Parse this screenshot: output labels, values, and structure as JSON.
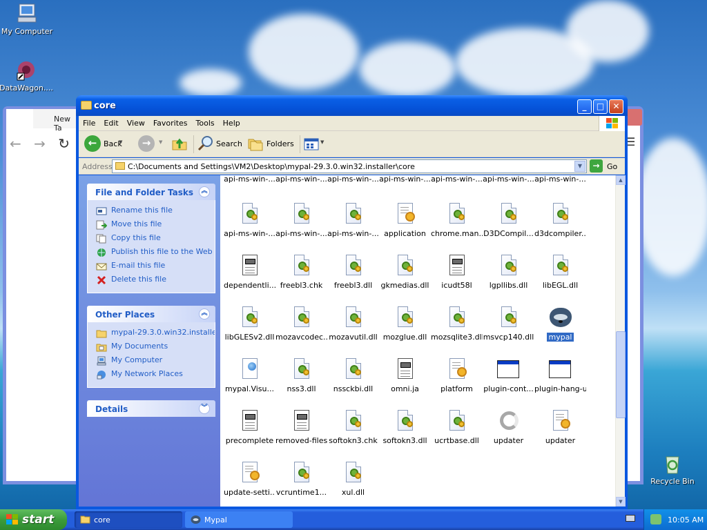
{
  "desktop": {
    "icons": [
      {
        "label": "My Computer",
        "icon": "my-computer-icon"
      },
      {
        "label": "DataWagon....",
        "icon": "datawagon-shortcut-icon"
      },
      {
        "label": "Recycle Bin",
        "icon": "recycle-bin-icon"
      }
    ]
  },
  "background_window": {
    "tab_label": "New Ta"
  },
  "explorer": {
    "title": "core",
    "menu": [
      "File",
      "Edit",
      "View",
      "Favorites",
      "Tools",
      "Help"
    ],
    "toolbar": {
      "back": "Back",
      "search": "Search",
      "folders": "Folders"
    },
    "address": {
      "label": "Address",
      "path": "C:\\Documents and Settings\\VM2\\Desktop\\mypal-29.3.0.win32.installer\\core",
      "go": "Go"
    },
    "file_tasks": {
      "title": "File and Folder Tasks",
      "items": [
        {
          "label": "Rename this file",
          "icon": "rename-icon"
        },
        {
          "label": "Move this file",
          "icon": "move-icon"
        },
        {
          "label": "Copy this file",
          "icon": "copy-icon"
        },
        {
          "label": "Publish this file to the Web",
          "icon": "publish-web-icon"
        },
        {
          "label": "E-mail this file",
          "icon": "email-icon"
        },
        {
          "label": "Delete this file",
          "icon": "delete-icon"
        }
      ]
    },
    "other_places": {
      "title": "Other Places",
      "items": [
        {
          "label": "mypal-29.3.0.win32.installe",
          "icon": "folder-icon"
        },
        {
          "label": "My Documents",
          "icon": "my-documents-icon"
        },
        {
          "label": "My Computer",
          "icon": "my-computer-icon"
        },
        {
          "label": "My Network Places",
          "icon": "network-places-icon"
        }
      ]
    },
    "details": {
      "title": "Details"
    },
    "files_partial_row": [
      "api-ms-win-...",
      "api-ms-win-...",
      "api-ms-win-...",
      "api-ms-win-...",
      "api-ms-win-...",
      "api-ms-win-...",
      "api-ms-win-..."
    ],
    "files": [
      {
        "name": "api-ms-win-...",
        "type": "dll"
      },
      {
        "name": "api-ms-win-...",
        "type": "dll"
      },
      {
        "name": "api-ms-win-...",
        "type": "dll"
      },
      {
        "name": "application",
        "type": "config"
      },
      {
        "name": "chrome.man...",
        "type": "dll"
      },
      {
        "name": "D3DCompil...",
        "type": "dll"
      },
      {
        "name": "d3dcompiler...",
        "type": "dll"
      },
      {
        "name": "dependentli...",
        "type": "text"
      },
      {
        "name": "freebl3.chk",
        "type": "dll"
      },
      {
        "name": "freebl3.dll",
        "type": "dll"
      },
      {
        "name": "gkmedias.dll",
        "type": "dll"
      },
      {
        "name": "icudt58l",
        "type": "text"
      },
      {
        "name": "lgpllibs.dll",
        "type": "dll"
      },
      {
        "name": "libEGL.dll",
        "type": "dll"
      },
      {
        "name": "libGLESv2.dll",
        "type": "dll"
      },
      {
        "name": "mozavcodec...",
        "type": "dll"
      },
      {
        "name": "mozavutil.dll",
        "type": "dll"
      },
      {
        "name": "mozglue.dll",
        "type": "dll"
      },
      {
        "name": "mozsqlite3.dll",
        "type": "dll"
      },
      {
        "name": "msvcp140.dll",
        "type": "dll"
      },
      {
        "name": "mypal",
        "type": "app-mypal",
        "selected": true
      },
      {
        "name": "mypal.Visu...",
        "type": "visual"
      },
      {
        "name": "nss3.dll",
        "type": "dll"
      },
      {
        "name": "nssckbi.dll",
        "type": "dll"
      },
      {
        "name": "omni.ja",
        "type": "text"
      },
      {
        "name": "platform",
        "type": "config"
      },
      {
        "name": "plugin-cont...",
        "type": "exe"
      },
      {
        "name": "plugin-hang-ui",
        "type": "exe"
      },
      {
        "name": "precomplete",
        "type": "text"
      },
      {
        "name": "removed-files",
        "type": "text"
      },
      {
        "name": "softokn3.chk",
        "type": "dll"
      },
      {
        "name": "softokn3.dll",
        "type": "dll"
      },
      {
        "name": "ucrtbase.dll",
        "type": "dll"
      },
      {
        "name": "updater",
        "type": "updater"
      },
      {
        "name": "updater",
        "type": "config"
      },
      {
        "name": "update-setti...",
        "type": "config"
      },
      {
        "name": "vcruntime1...",
        "type": "dll"
      },
      {
        "name": "xul.dll",
        "type": "dll"
      }
    ]
  },
  "taskbar": {
    "start": "start",
    "buttons": [
      {
        "label": "core",
        "icon": "folder-icon"
      },
      {
        "label": "Mypal",
        "icon": "mypal-icon"
      }
    ],
    "clock": "10:05 AM"
  }
}
